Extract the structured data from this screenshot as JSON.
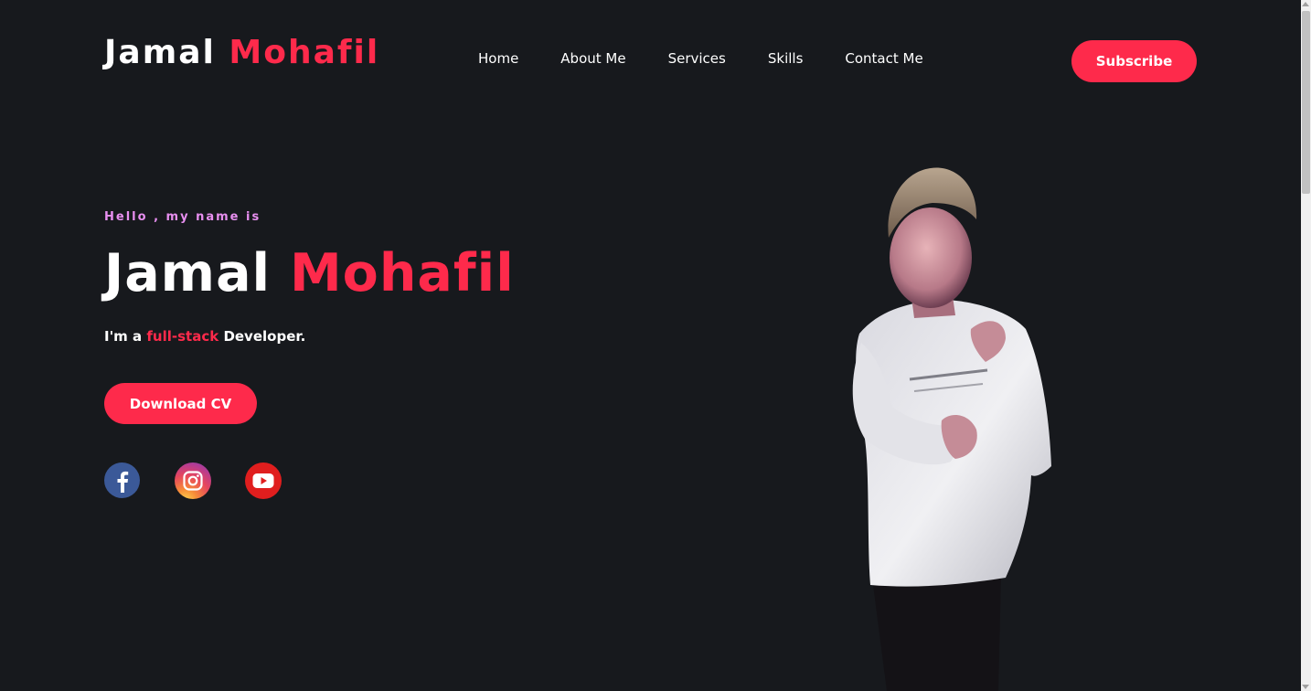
{
  "header": {
    "logo_first": "Jamal",
    "logo_second": "Mohafil",
    "nav": [
      {
        "label": "Home"
      },
      {
        "label": "About Me"
      },
      {
        "label": "Services"
      },
      {
        "label": "Skills"
      },
      {
        "label": "Contact Me"
      }
    ],
    "subscribe_label": "Subscribe"
  },
  "hero": {
    "greeting": "Hello , my name is",
    "name_first": "Jamal",
    "name_second": "Mohafil",
    "tagline_prefix": "I'm a",
    "tagline_highlight": "full-stack",
    "tagline_suffix": "Developer.",
    "download_label": "Download CV"
  },
  "social": [
    {
      "icon": "facebook-icon"
    },
    {
      "icon": "instagram-icon"
    },
    {
      "icon": "youtube-icon"
    }
  ],
  "colors": {
    "background": "#17191d",
    "accent": "#fe2a4b",
    "greeting": "#e88ff0",
    "text": "#ffffff"
  }
}
